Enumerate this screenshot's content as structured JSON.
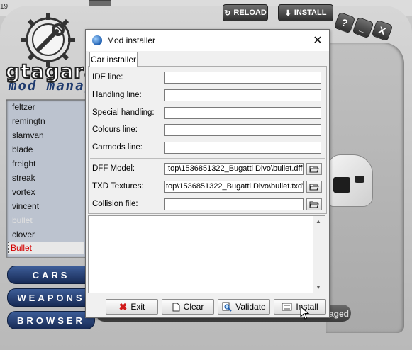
{
  "background": {
    "top_number": "19",
    "reload_label": "RELOAD",
    "install_label": "INSTALL",
    "help_label": "?",
    "minimize_label": "_",
    "close_label": "X",
    "brand": "gtagarag",
    "brand_sub": "mod manage",
    "car_list": [
      "feltzer",
      "remingtn",
      "slamvan",
      "blade",
      "freight",
      "streak",
      "vortex",
      "vincent",
      "bullet",
      "clover"
    ],
    "selected_item": "Bullet",
    "nav": {
      "cars": "CARS",
      "weapons": "WEAPONS",
      "browser": "BROWSER"
    },
    "managed_label": "Managed"
  },
  "dialog": {
    "title": "Mod installer",
    "close_glyph": "✕",
    "tab_label": "Car installer",
    "labels": {
      "ide": "IDE line:",
      "handling": "Handling line:",
      "special": "Special handling:",
      "colours": "Colours line:",
      "carmods": "Carmods line:",
      "dff": "DFF Model:",
      "txd": "TXD Textures:",
      "collision": "Collision file:"
    },
    "values": {
      "ide": "",
      "handling": "",
      "special": "",
      "colours": "",
      "carmods": "",
      "dff": ":top\\1536851322_Bugatti Divo\\bullet.dff\"|",
      "txd": "top\\1536851322_Bugatti Divo\\bullet.txd\"",
      "collision": ""
    },
    "log_text": "",
    "buttons": {
      "exit": "Exit",
      "clear": "Clear",
      "validate": "Validate",
      "install": "Install"
    }
  },
  "colors": {
    "exit_icon": "#d11a1a",
    "nav_blue": "#2a4680",
    "selected_red": "#d40000"
  }
}
